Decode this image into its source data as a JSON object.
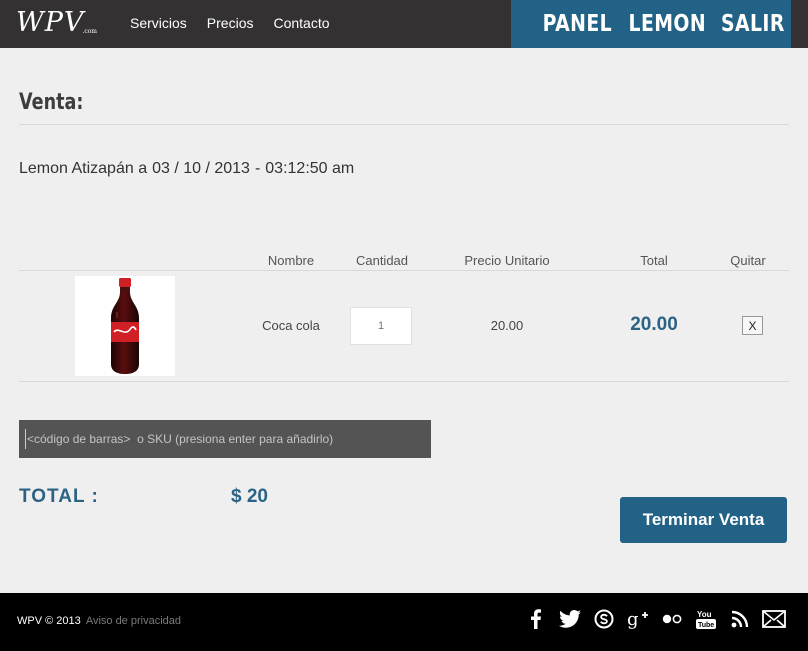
{
  "header": {
    "logo": "WPV",
    "logo_suffix": ".com",
    "nav": [
      "Servicios",
      "Precios",
      "Contacto"
    ],
    "user_nav": [
      "PANEL",
      "LEMON",
      "SALIR"
    ]
  },
  "page": {
    "title": "Venta:",
    "sale_info": {
      "store": "Lemon Atizapán a",
      "date": "03 / 10 / 2013",
      "separator": "-",
      "time": "03:12:50 am"
    }
  },
  "table": {
    "headers": {
      "name": "Nombre",
      "quantity": "Cantidad",
      "unit_price": "Precio Unitario",
      "total": "Total",
      "remove": "Quitar"
    },
    "rows": [
      {
        "name": "Coca cola",
        "quantity": "1",
        "unit_price": "20.00",
        "total": "20.00",
        "remove_label": "X",
        "image_icon": "soda-bottle"
      }
    ]
  },
  "sku_input": {
    "value": "",
    "placeholder": "<código de barras>  o SKU (presiona enter para añadirlo)"
  },
  "summary": {
    "total_label": "TOTAL :",
    "total_value": "$ 20",
    "finish_label": "Terminar Venta"
  },
  "footer": {
    "copyright": "WPV © 2013",
    "privacy": "Aviso de privacidad",
    "social_icons": [
      "facebook-icon",
      "twitter-icon",
      "skype-icon",
      "google-plus-icon",
      "flickr-icon",
      "youtube-icon",
      "rss-icon",
      "mail-icon"
    ]
  },
  "colors": {
    "topbar": "#333131",
    "accent": "#236287",
    "total_text": "#2b6385",
    "footer": "#000000"
  }
}
